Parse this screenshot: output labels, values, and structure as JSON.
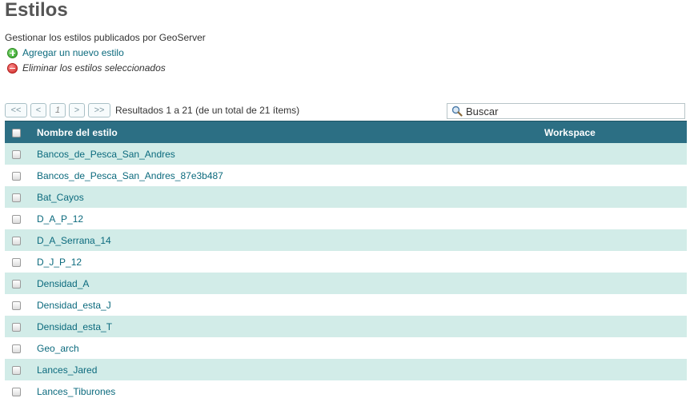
{
  "page": {
    "title": "Estilos",
    "description": "Gestionar los estilos publicados por GeoServer"
  },
  "actions": {
    "add_label": "Agregar un nuevo estilo",
    "remove_label": "Eliminar los estilos seleccionados"
  },
  "pager": {
    "first": "<<",
    "prev": "<",
    "current": "1",
    "next": ">",
    "last": ">>",
    "results_text": "Resultados 1 a 21 (de un total de 21 ítems)"
  },
  "search": {
    "placeholder": "Buscar"
  },
  "table": {
    "headers": {
      "name": "Nombre del estilo",
      "workspace": "Workspace"
    },
    "rows": [
      {
        "name": "Bancos_de_Pesca_San_Andres",
        "workspace": ""
      },
      {
        "name": "Bancos_de_Pesca_San_Andres_87e3b487",
        "workspace": ""
      },
      {
        "name": "Bat_Cayos",
        "workspace": ""
      },
      {
        "name": "D_A_P_12",
        "workspace": ""
      },
      {
        "name": "D_A_Serrana_14",
        "workspace": ""
      },
      {
        "name": "D_J_P_12",
        "workspace": ""
      },
      {
        "name": "Densidad_A",
        "workspace": ""
      },
      {
        "name": "Densidad_esta_J",
        "workspace": ""
      },
      {
        "name": "Densidad_esta_T",
        "workspace": ""
      },
      {
        "name": "Geo_arch",
        "workspace": ""
      },
      {
        "name": "Lances_Jared",
        "workspace": ""
      },
      {
        "name": "Lances_Tiburones",
        "workspace": ""
      }
    ]
  },
  "colors": {
    "header_bg": "#2c6f84",
    "row_alt_bg": "#d2ece8",
    "link": "#0b6a7d"
  }
}
